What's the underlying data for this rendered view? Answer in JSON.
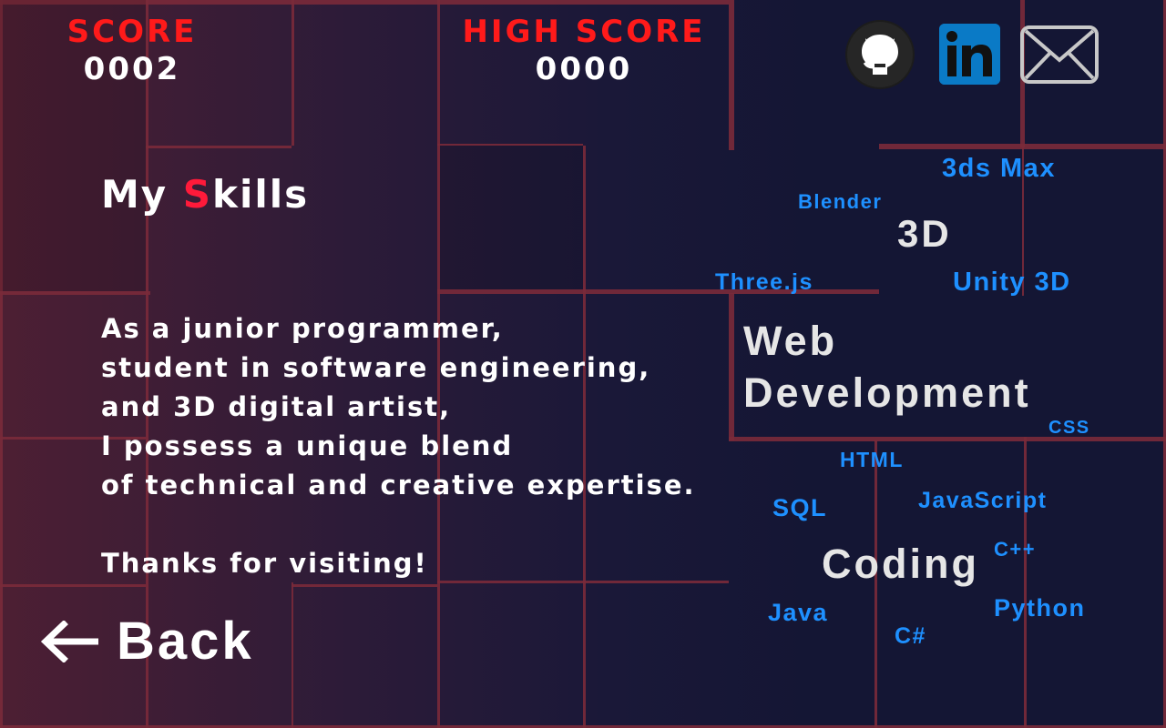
{
  "hud": {
    "score_label": "SCORE",
    "score_value": "0002",
    "high_score_label": "HIGH SCORE",
    "high_score_value": "0000"
  },
  "social": {
    "github": "github-icon",
    "linkedin": "linkedin-icon",
    "mail": "mail-icon",
    "linkedin_text": "in"
  },
  "skills_section": {
    "title_before": "My ",
    "title_accent": "S",
    "title_after": "kills",
    "about_lines": [
      "As a junior programmer,",
      "student in software engineering,",
      "and 3D digital artist,",
      "I possess a unique blend",
      "of technical and creative expertise."
    ],
    "thanks": "Thanks for visiting!"
  },
  "back": {
    "label": "Back",
    "icon": "arrow-left-icon"
  },
  "skill_cloud": {
    "categories": {
      "three_d": "3D",
      "web_line1": "Web",
      "web_line2": "Development",
      "coding": "Coding"
    },
    "three_d_skills": {
      "max": "3ds Max",
      "blender": "Blender",
      "threejs": "Three.js",
      "unity": "Unity 3D"
    },
    "web_skills": {
      "css": "CSS",
      "html": "HTML",
      "javascript": "JavaScript"
    },
    "coding_skills": {
      "sql": "SQL",
      "cpp": "C++",
      "java": "Java",
      "python": "Python",
      "csharp": "C#"
    }
  },
  "colors": {
    "accent_red": "#ff1a1a",
    "skill_blue": "#1e90ff",
    "category_gray": "#e6e6e6",
    "grid_line": "#7a2a3a",
    "linkedin_blue": "#0a7ac6"
  }
}
